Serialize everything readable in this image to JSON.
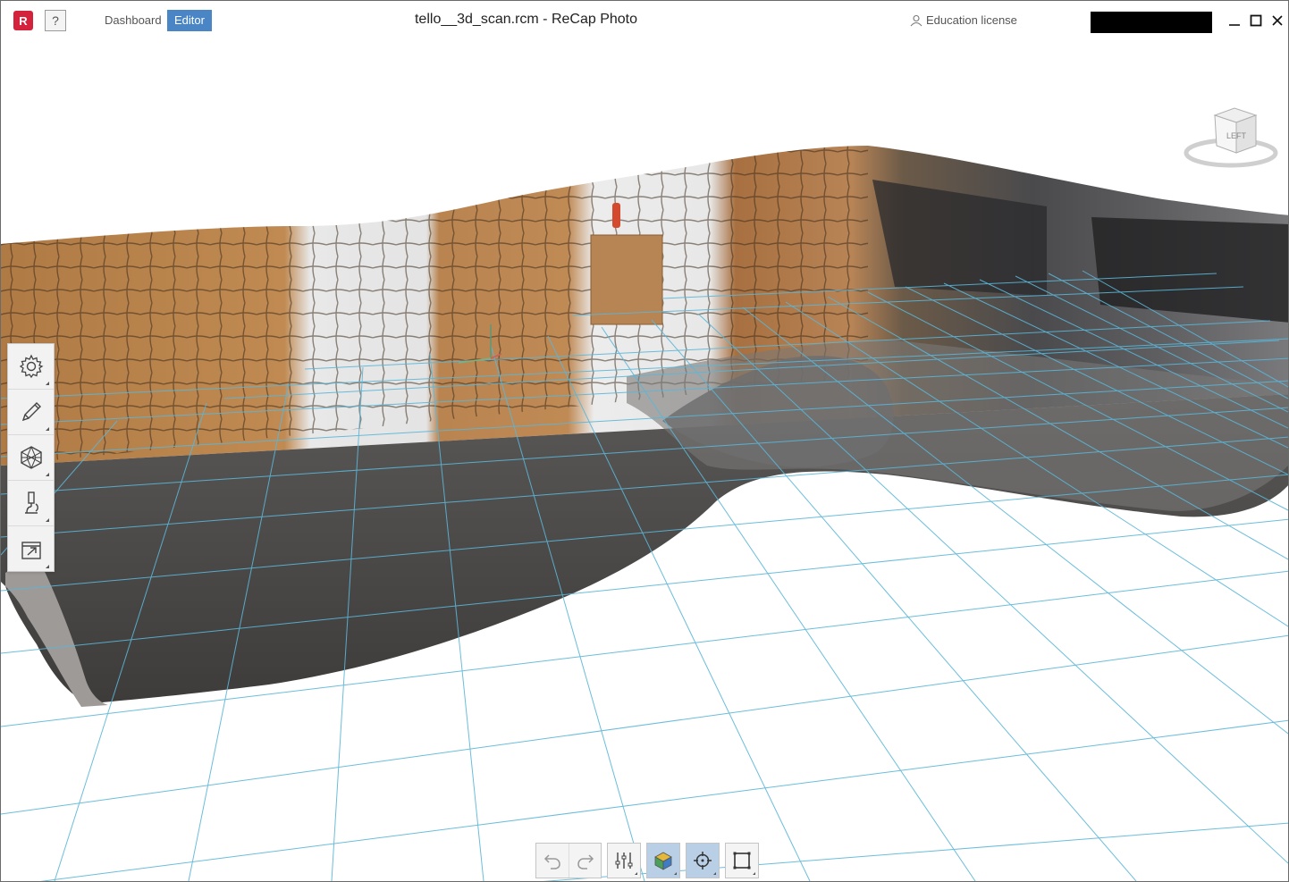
{
  "app": {
    "logo_letter": "R",
    "help_label": "?",
    "window_title": "tello__3d_scan.rcm - ReCap Photo",
    "license_text": "Education license",
    "brand_color": "#d4223c"
  },
  "nav": {
    "tabs": [
      {
        "label": "Dashboard",
        "active": false
      },
      {
        "label": "Editor",
        "active": true
      }
    ],
    "active_color": "#4a86c5"
  },
  "window_controls": [
    "minimize-icon",
    "maximize-icon",
    "close-icon"
  ],
  "viewcube": {
    "face_label": "LEFT"
  },
  "left_toolbar": {
    "items": [
      {
        "icon": "settings-gear-icon"
      },
      {
        "icon": "pencil-edit-icon"
      },
      {
        "icon": "mesh-polyhedron-icon"
      },
      {
        "icon": "microscope-analyze-icon"
      },
      {
        "icon": "export-icon"
      }
    ]
  },
  "bottom_toolbar": {
    "groups": [
      {
        "items": [
          {
            "icon": "undo-icon",
            "active": false
          },
          {
            "icon": "redo-icon",
            "active": false
          }
        ]
      },
      {
        "items": [
          {
            "icon": "sliders-adjust-icon",
            "active": false
          }
        ]
      },
      {
        "items": [
          {
            "icon": "render-mode-cube-icon",
            "active": true
          }
        ]
      },
      {
        "items": [
          {
            "icon": "pivot-target-icon",
            "active": true
          }
        ]
      },
      {
        "items": [
          {
            "icon": "crop-box-icon",
            "active": false
          }
        ]
      }
    ]
  },
  "grid_color": "#5bb6d8"
}
